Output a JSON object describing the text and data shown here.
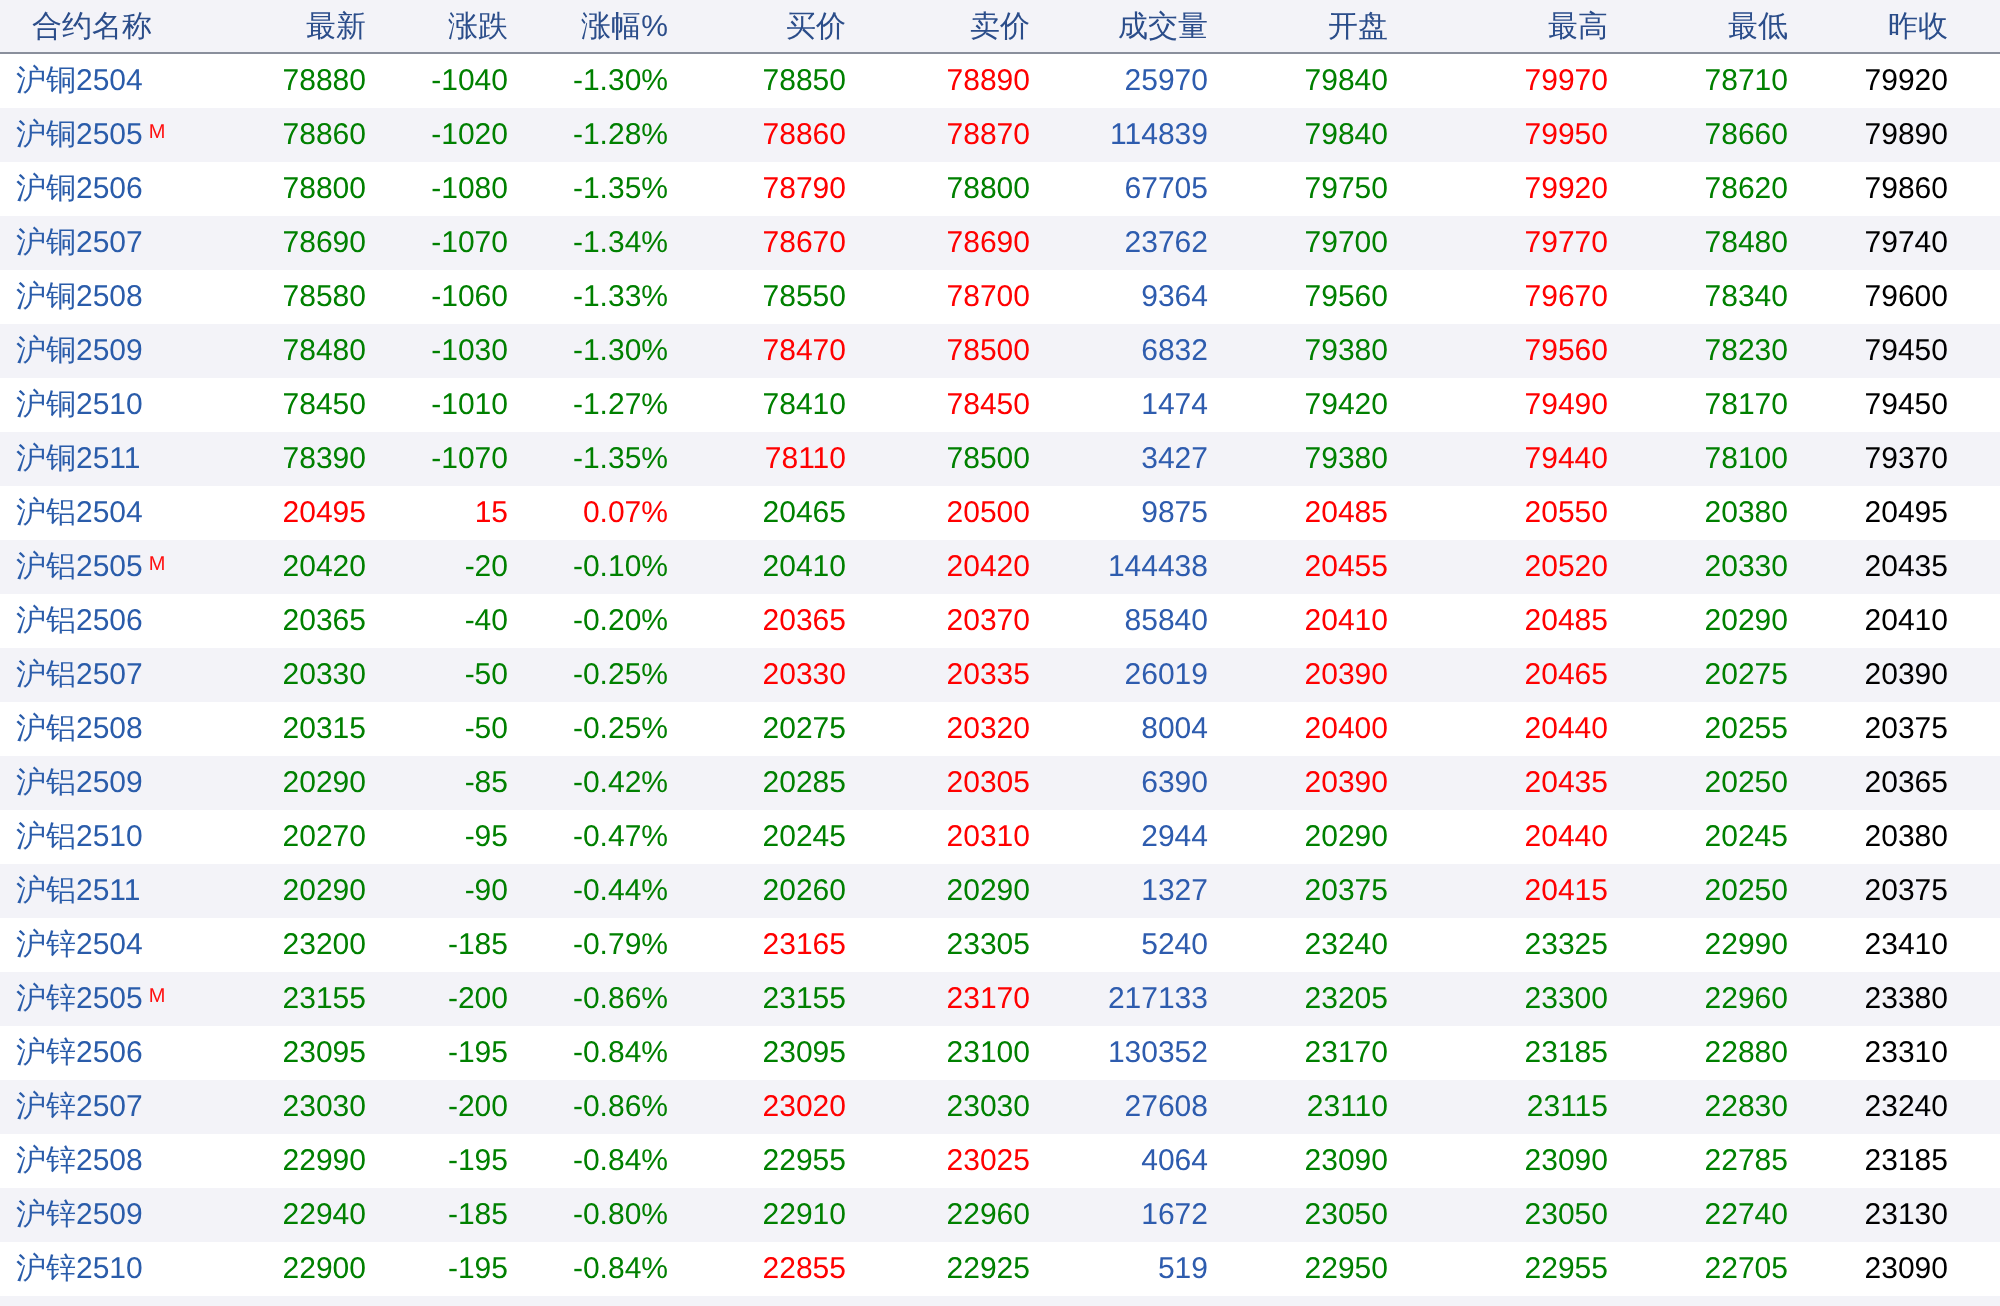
{
  "columns": [
    {
      "label": "合约名称",
      "kind": "name"
    },
    {
      "label": "最新",
      "kind": "price"
    },
    {
      "label": "涨跌",
      "kind": "price"
    },
    {
      "label": "涨幅%",
      "kind": "price"
    },
    {
      "label": "买价",
      "kind": "price"
    },
    {
      "label": "卖价",
      "kind": "price"
    },
    {
      "label": "成交量",
      "kind": "volume"
    },
    {
      "label": "开盘",
      "kind": "price"
    },
    {
      "label": "最高",
      "kind": "price"
    },
    {
      "label": "最低",
      "kind": "price"
    },
    {
      "label": "昨收",
      "kind": "plain"
    }
  ],
  "rows": [
    {
      "name": "沪铜2504",
      "cells": [
        {
          "text": "78880",
          "color": "#008000"
        },
        {
          "text": "-1040",
          "color": "#008000"
        },
        {
          "text": "-1.30%",
          "color": "#008000"
        },
        {
          "text": "78850",
          "color": "#008000"
        },
        {
          "text": "78890",
          "color": "#ff0000"
        },
        {
          "text": "25970"
        },
        {
          "text": "79840",
          "color": "#008000"
        },
        {
          "text": "79970",
          "color": "#ff0000"
        },
        {
          "text": "78710",
          "color": "#008000"
        },
        {
          "text": "79920"
        }
      ]
    },
    {
      "name": "沪铜2505",
      "badge": "M",
      "cells": [
        {
          "text": "78860",
          "color": "#008000"
        },
        {
          "text": "-1020",
          "color": "#008000"
        },
        {
          "text": "-1.28%",
          "color": "#008000"
        },
        {
          "text": "78860",
          "color": "#ff0000"
        },
        {
          "text": "78870",
          "color": "#ff0000"
        },
        {
          "text": "114839"
        },
        {
          "text": "79840",
          "color": "#008000"
        },
        {
          "text": "79950",
          "color": "#ff0000"
        },
        {
          "text": "78660",
          "color": "#008000"
        },
        {
          "text": "79890"
        }
      ]
    },
    {
      "name": "沪铜2506",
      "cells": [
        {
          "text": "78800",
          "color": "#008000"
        },
        {
          "text": "-1080",
          "color": "#008000"
        },
        {
          "text": "-1.35%",
          "color": "#008000"
        },
        {
          "text": "78790",
          "color": "#ff0000"
        },
        {
          "text": "78800",
          "color": "#008000"
        },
        {
          "text": "67705"
        },
        {
          "text": "79750",
          "color": "#008000"
        },
        {
          "text": "79920",
          "color": "#ff0000"
        },
        {
          "text": "78620",
          "color": "#008000"
        },
        {
          "text": "79860"
        }
      ]
    },
    {
      "name": "沪铜2507",
      "cells": [
        {
          "text": "78690",
          "color": "#008000"
        },
        {
          "text": "-1070",
          "color": "#008000"
        },
        {
          "text": "-1.34%",
          "color": "#008000"
        },
        {
          "text": "78670",
          "color": "#ff0000"
        },
        {
          "text": "78690",
          "color": "#ff0000"
        },
        {
          "text": "23762"
        },
        {
          "text": "79700",
          "color": "#008000"
        },
        {
          "text": "79770",
          "color": "#ff0000"
        },
        {
          "text": "78480",
          "color": "#008000"
        },
        {
          "text": "79740"
        }
      ]
    },
    {
      "name": "沪铜2508",
      "cells": [
        {
          "text": "78580",
          "color": "#008000"
        },
        {
          "text": "-1060",
          "color": "#008000"
        },
        {
          "text": "-1.33%",
          "color": "#008000"
        },
        {
          "text": "78550",
          "color": "#008000"
        },
        {
          "text": "78700",
          "color": "#ff0000"
        },
        {
          "text": "9364"
        },
        {
          "text": "79560",
          "color": "#008000"
        },
        {
          "text": "79670",
          "color": "#ff0000"
        },
        {
          "text": "78340",
          "color": "#008000"
        },
        {
          "text": "79600"
        }
      ]
    },
    {
      "name": "沪铜2509",
      "cells": [
        {
          "text": "78480",
          "color": "#008000"
        },
        {
          "text": "-1030",
          "color": "#008000"
        },
        {
          "text": "-1.30%",
          "color": "#008000"
        },
        {
          "text": "78470",
          "color": "#ff0000"
        },
        {
          "text": "78500",
          "color": "#ff0000"
        },
        {
          "text": "6832"
        },
        {
          "text": "79380",
          "color": "#008000"
        },
        {
          "text": "79560",
          "color": "#ff0000"
        },
        {
          "text": "78230",
          "color": "#008000"
        },
        {
          "text": "79450"
        }
      ]
    },
    {
      "name": "沪铜2510",
      "cells": [
        {
          "text": "78450",
          "color": "#008000"
        },
        {
          "text": "-1010",
          "color": "#008000"
        },
        {
          "text": "-1.27%",
          "color": "#008000"
        },
        {
          "text": "78410",
          "color": "#008000"
        },
        {
          "text": "78450",
          "color": "#ff0000"
        },
        {
          "text": "1474"
        },
        {
          "text": "79420",
          "color": "#008000"
        },
        {
          "text": "79490",
          "color": "#ff0000"
        },
        {
          "text": "78170",
          "color": "#008000"
        },
        {
          "text": "79450"
        }
      ]
    },
    {
      "name": "沪铜2511",
      "cells": [
        {
          "text": "78390",
          "color": "#008000"
        },
        {
          "text": "-1070",
          "color": "#008000"
        },
        {
          "text": "-1.35%",
          "color": "#008000"
        },
        {
          "text": "78110",
          "color": "#ff0000"
        },
        {
          "text": "78500",
          "color": "#008000"
        },
        {
          "text": "3427"
        },
        {
          "text": "79380",
          "color": "#008000"
        },
        {
          "text": "79440",
          "color": "#ff0000"
        },
        {
          "text": "78100",
          "color": "#008000"
        },
        {
          "text": "79370"
        }
      ]
    },
    {
      "name": "沪铝2504",
      "cells": [
        {
          "text": "20495",
          "color": "#ff0000"
        },
        {
          "text": "15",
          "color": "#ff0000"
        },
        {
          "text": "0.07%",
          "color": "#ff0000"
        },
        {
          "text": "20465",
          "color": "#008000"
        },
        {
          "text": "20500",
          "color": "#ff0000"
        },
        {
          "text": "9875"
        },
        {
          "text": "20485",
          "color": "#ff0000"
        },
        {
          "text": "20550",
          "color": "#ff0000"
        },
        {
          "text": "20380",
          "color": "#008000"
        },
        {
          "text": "20495"
        }
      ]
    },
    {
      "name": "沪铝2505",
      "badge": "M",
      "cells": [
        {
          "text": "20420",
          "color": "#008000"
        },
        {
          "text": "-20",
          "color": "#008000"
        },
        {
          "text": "-0.10%",
          "color": "#008000"
        },
        {
          "text": "20410",
          "color": "#008000"
        },
        {
          "text": "20420",
          "color": "#ff0000"
        },
        {
          "text": "144438"
        },
        {
          "text": "20455",
          "color": "#ff0000"
        },
        {
          "text": "20520",
          "color": "#ff0000"
        },
        {
          "text": "20330",
          "color": "#008000"
        },
        {
          "text": "20435"
        }
      ]
    },
    {
      "name": "沪铝2506",
      "cells": [
        {
          "text": "20365",
          "color": "#008000"
        },
        {
          "text": "-40",
          "color": "#008000"
        },
        {
          "text": "-0.20%",
          "color": "#008000"
        },
        {
          "text": "20365",
          "color": "#ff0000"
        },
        {
          "text": "20370",
          "color": "#ff0000"
        },
        {
          "text": "85840"
        },
        {
          "text": "20410",
          "color": "#ff0000"
        },
        {
          "text": "20485",
          "color": "#ff0000"
        },
        {
          "text": "20290",
          "color": "#008000"
        },
        {
          "text": "20410"
        }
      ]
    },
    {
      "name": "沪铝2507",
      "cells": [
        {
          "text": "20330",
          "color": "#008000"
        },
        {
          "text": "-50",
          "color": "#008000"
        },
        {
          "text": "-0.25%",
          "color": "#008000"
        },
        {
          "text": "20330",
          "color": "#ff0000"
        },
        {
          "text": "20335",
          "color": "#ff0000"
        },
        {
          "text": "26019"
        },
        {
          "text": "20390",
          "color": "#ff0000"
        },
        {
          "text": "20465",
          "color": "#ff0000"
        },
        {
          "text": "20275",
          "color": "#008000"
        },
        {
          "text": "20390"
        }
      ]
    },
    {
      "name": "沪铝2508",
      "cells": [
        {
          "text": "20315",
          "color": "#008000"
        },
        {
          "text": "-50",
          "color": "#008000"
        },
        {
          "text": "-0.25%",
          "color": "#008000"
        },
        {
          "text": "20275",
          "color": "#008000"
        },
        {
          "text": "20320",
          "color": "#ff0000"
        },
        {
          "text": "8004"
        },
        {
          "text": "20400",
          "color": "#ff0000"
        },
        {
          "text": "20440",
          "color": "#ff0000"
        },
        {
          "text": "20255",
          "color": "#008000"
        },
        {
          "text": "20375"
        }
      ]
    },
    {
      "name": "沪铝2509",
      "cells": [
        {
          "text": "20290",
          "color": "#008000"
        },
        {
          "text": "-85",
          "color": "#008000"
        },
        {
          "text": "-0.42%",
          "color": "#008000"
        },
        {
          "text": "20285",
          "color": "#008000"
        },
        {
          "text": "20305",
          "color": "#ff0000"
        },
        {
          "text": "6390"
        },
        {
          "text": "20390",
          "color": "#ff0000"
        },
        {
          "text": "20435",
          "color": "#ff0000"
        },
        {
          "text": "20250",
          "color": "#008000"
        },
        {
          "text": "20365"
        }
      ]
    },
    {
      "name": "沪铝2510",
      "cells": [
        {
          "text": "20270",
          "color": "#008000"
        },
        {
          "text": "-95",
          "color": "#008000"
        },
        {
          "text": "-0.47%",
          "color": "#008000"
        },
        {
          "text": "20245",
          "color": "#008000"
        },
        {
          "text": "20310",
          "color": "#ff0000"
        },
        {
          "text": "2944"
        },
        {
          "text": "20290",
          "color": "#008000"
        },
        {
          "text": "20440",
          "color": "#ff0000"
        },
        {
          "text": "20245",
          "color": "#008000"
        },
        {
          "text": "20380"
        }
      ]
    },
    {
      "name": "沪铝2511",
      "cells": [
        {
          "text": "20290",
          "color": "#008000"
        },
        {
          "text": "-90",
          "color": "#008000"
        },
        {
          "text": "-0.44%",
          "color": "#008000"
        },
        {
          "text": "20260",
          "color": "#008000"
        },
        {
          "text": "20290",
          "color": "#008000"
        },
        {
          "text": "1327"
        },
        {
          "text": "20375",
          "color": "#008000"
        },
        {
          "text": "20415",
          "color": "#ff0000"
        },
        {
          "text": "20250",
          "color": "#008000"
        },
        {
          "text": "20375"
        }
      ]
    },
    {
      "name": "沪锌2504",
      "cells": [
        {
          "text": "23200",
          "color": "#008000"
        },
        {
          "text": "-185",
          "color": "#008000"
        },
        {
          "text": "-0.79%",
          "color": "#008000"
        },
        {
          "text": "23165",
          "color": "#ff0000"
        },
        {
          "text": "23305",
          "color": "#008000"
        },
        {
          "text": "5240"
        },
        {
          "text": "23240",
          "color": "#008000"
        },
        {
          "text": "23325",
          "color": "#008000"
        },
        {
          "text": "22990",
          "color": "#008000"
        },
        {
          "text": "23410"
        }
      ]
    },
    {
      "name": "沪锌2505",
      "badge": "M",
      "cells": [
        {
          "text": "23155",
          "color": "#008000"
        },
        {
          "text": "-200",
          "color": "#008000"
        },
        {
          "text": "-0.86%",
          "color": "#008000"
        },
        {
          "text": "23155",
          "color": "#008000"
        },
        {
          "text": "23170",
          "color": "#ff0000"
        },
        {
          "text": "217133"
        },
        {
          "text": "23205",
          "color": "#008000"
        },
        {
          "text": "23300",
          "color": "#008000"
        },
        {
          "text": "22960",
          "color": "#008000"
        },
        {
          "text": "23380"
        }
      ]
    },
    {
      "name": "沪锌2506",
      "cells": [
        {
          "text": "23095",
          "color": "#008000"
        },
        {
          "text": "-195",
          "color": "#008000"
        },
        {
          "text": "-0.84%",
          "color": "#008000"
        },
        {
          "text": "23095",
          "color": "#008000"
        },
        {
          "text": "23100",
          "color": "#008000"
        },
        {
          "text": "130352"
        },
        {
          "text": "23170",
          "color": "#008000"
        },
        {
          "text": "23185",
          "color": "#008000"
        },
        {
          "text": "22880",
          "color": "#008000"
        },
        {
          "text": "23310"
        }
      ]
    },
    {
      "name": "沪锌2507",
      "cells": [
        {
          "text": "23030",
          "color": "#008000"
        },
        {
          "text": "-200",
          "color": "#008000"
        },
        {
          "text": "-0.86%",
          "color": "#008000"
        },
        {
          "text": "23020",
          "color": "#ff0000"
        },
        {
          "text": "23030",
          "color": "#008000"
        },
        {
          "text": "27608"
        },
        {
          "text": "23110",
          "color": "#008000"
        },
        {
          "text": "23115",
          "color": "#008000"
        },
        {
          "text": "22830",
          "color": "#008000"
        },
        {
          "text": "23240"
        }
      ]
    },
    {
      "name": "沪锌2508",
      "cells": [
        {
          "text": "22990",
          "color": "#008000"
        },
        {
          "text": "-195",
          "color": "#008000"
        },
        {
          "text": "-0.84%",
          "color": "#008000"
        },
        {
          "text": "22955",
          "color": "#008000"
        },
        {
          "text": "23025",
          "color": "#ff0000"
        },
        {
          "text": "4064"
        },
        {
          "text": "23090",
          "color": "#008000"
        },
        {
          "text": "23090",
          "color": "#008000"
        },
        {
          "text": "22785",
          "color": "#008000"
        },
        {
          "text": "23185"
        }
      ]
    },
    {
      "name": "沪锌2509",
      "cells": [
        {
          "text": "22940",
          "color": "#008000"
        },
        {
          "text": "-185",
          "color": "#008000"
        },
        {
          "text": "-0.80%",
          "color": "#008000"
        },
        {
          "text": "22910",
          "color": "#008000"
        },
        {
          "text": "22960",
          "color": "#008000"
        },
        {
          "text": "1672"
        },
        {
          "text": "23050",
          "color": "#008000"
        },
        {
          "text": "23050",
          "color": "#008000"
        },
        {
          "text": "22740",
          "color": "#008000"
        },
        {
          "text": "23130"
        }
      ]
    },
    {
      "name": "沪锌2510",
      "cells": [
        {
          "text": "22900",
          "color": "#008000"
        },
        {
          "text": "-195",
          "color": "#008000"
        },
        {
          "text": "-0.84%",
          "color": "#008000"
        },
        {
          "text": "22855",
          "color": "#ff0000"
        },
        {
          "text": "22925",
          "color": "#008000"
        },
        {
          "text": "519"
        },
        {
          "text": "22950",
          "color": "#008000"
        },
        {
          "text": "22955",
          "color": "#008000"
        },
        {
          "text": "22705",
          "color": "#008000"
        },
        {
          "text": "23090"
        }
      ]
    }
  ]
}
